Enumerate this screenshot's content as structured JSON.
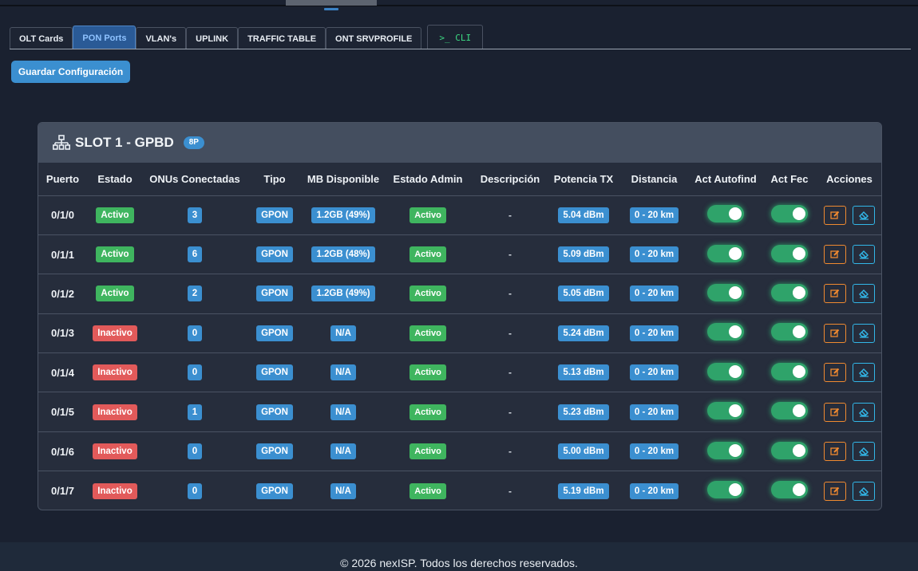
{
  "tabs": [
    {
      "label": "OLT Cards"
    },
    {
      "label": "PON Ports"
    },
    {
      "label": "VLAN's"
    },
    {
      "label": "UPLINK"
    },
    {
      "label": "TRAFFIC TABLE"
    },
    {
      "label": "ONT SRVPROFILE"
    }
  ],
  "cli_tab": ">_ CLI",
  "save_button": "Guardar Configuración",
  "slot": {
    "title": "SLOT 1 - GPBD",
    "badge": "8P",
    "icon": "network-icon"
  },
  "columns": [
    "Puerto",
    "Estado",
    "ONUs Conectadas",
    "Tipo",
    "MB Disponible",
    "Estado Admin",
    "Descripción",
    "Potencia TX",
    "Distancia",
    "Act Autofind",
    "Act Fec",
    "Acciones"
  ],
  "status_colors": {
    "active": "#3fb55f",
    "inactive": "#e25a5a",
    "info": "#3b8fd0"
  },
  "rows": [
    {
      "puerto": "0/1/0",
      "estado": "Activo",
      "estado_type": "active",
      "onus": "3",
      "tipo": "GPON",
      "mb": "1.2GB (49%)",
      "admin": "Activo",
      "desc": "-",
      "tx": "5.04 dBm",
      "dist": "0 - 20 km"
    },
    {
      "puerto": "0/1/1",
      "estado": "Activo",
      "estado_type": "active",
      "onus": "6",
      "tipo": "GPON",
      "mb": "1.2GB (48%)",
      "admin": "Activo",
      "desc": "-",
      "tx": "5.09 dBm",
      "dist": "0 - 20 km"
    },
    {
      "puerto": "0/1/2",
      "estado": "Activo",
      "estado_type": "active",
      "onus": "2",
      "tipo": "GPON",
      "mb": "1.2GB (49%)",
      "admin": "Activo",
      "desc": "-",
      "tx": "5.05 dBm",
      "dist": "0 - 20 km"
    },
    {
      "puerto": "0/1/3",
      "estado": "Inactivo",
      "estado_type": "inactive",
      "onus": "0",
      "tipo": "GPON",
      "mb": "N/A",
      "admin": "Activo",
      "desc": "-",
      "tx": "5.24 dBm",
      "dist": "0 - 20 km"
    },
    {
      "puerto": "0/1/4",
      "estado": "Inactivo",
      "estado_type": "inactive",
      "onus": "0",
      "tipo": "GPON",
      "mb": "N/A",
      "admin": "Activo",
      "desc": "-",
      "tx": "5.13 dBm",
      "dist": "0 - 20 km"
    },
    {
      "puerto": "0/1/5",
      "estado": "Inactivo",
      "estado_type": "inactive",
      "onus": "1",
      "tipo": "GPON",
      "mb": "N/A",
      "admin": "Activo",
      "desc": "-",
      "tx": "5.23 dBm",
      "dist": "0 - 20 km"
    },
    {
      "puerto": "0/1/6",
      "estado": "Inactivo",
      "estado_type": "inactive",
      "onus": "0",
      "tipo": "GPON",
      "mb": "N/A",
      "admin": "Activo",
      "desc": "-",
      "tx": "5.00 dBm",
      "dist": "0 - 20 km"
    },
    {
      "puerto": "0/1/7",
      "estado": "Inactivo",
      "estado_type": "inactive",
      "onus": "0",
      "tipo": "GPON",
      "mb": "N/A",
      "admin": "Activo",
      "desc": "-",
      "tx": "5.19 dBm",
      "dist": "0 - 20 km"
    }
  ],
  "row_icons": {
    "edit": "edit-icon",
    "erase": "eraser-icon"
  },
  "footer": "© 2026 nexISP. Todos los derechos reservados."
}
